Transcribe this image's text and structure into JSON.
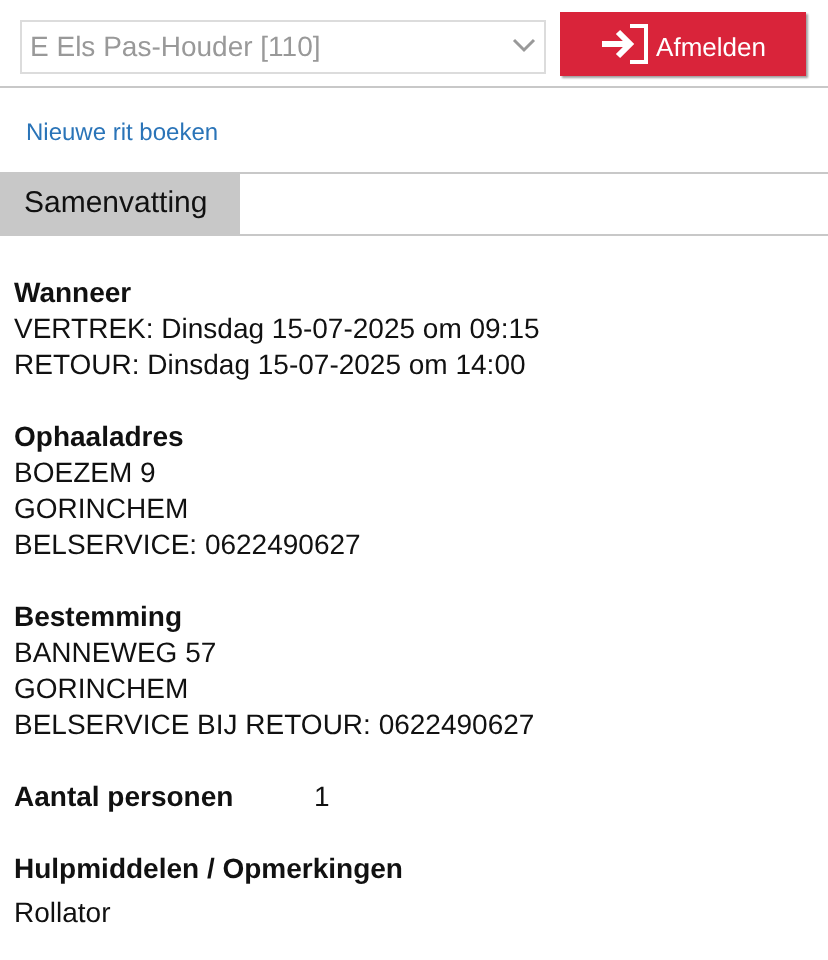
{
  "account_select": {
    "value": "E Els Pas-Houder [110]"
  },
  "logout_button": {
    "label": "Afmelden"
  },
  "new_ride_link": "Nieuwe rit boeken",
  "tabs": [
    {
      "label": "Samenvatting",
      "selected": true
    }
  ],
  "sections": [
    {
      "heading": "Wanneer",
      "lines": [
        "VERTREK: Dinsdag 15-07-2025 om 09:15",
        "RETOUR: Dinsdag 15-07-2025 om 14:00"
      ]
    },
    {
      "heading": "Ophaaladres",
      "lines": [
        "BOEZEM 9",
        "GORINCHEM",
        "BELSERVICE: 0622490627"
      ]
    },
    {
      "heading": "Bestemming",
      "lines": [
        "BANNEWEG 57",
        "GORINCHEM",
        "BELSERVICE BIJ RETOUR: 0622490627"
      ]
    }
  ],
  "persons": {
    "label": "Aantal personen",
    "value": "1"
  },
  "remarks": {
    "heading": "Hulpmiddelen / Opmerkingen",
    "lines": [
      "Rollator"
    ]
  }
}
